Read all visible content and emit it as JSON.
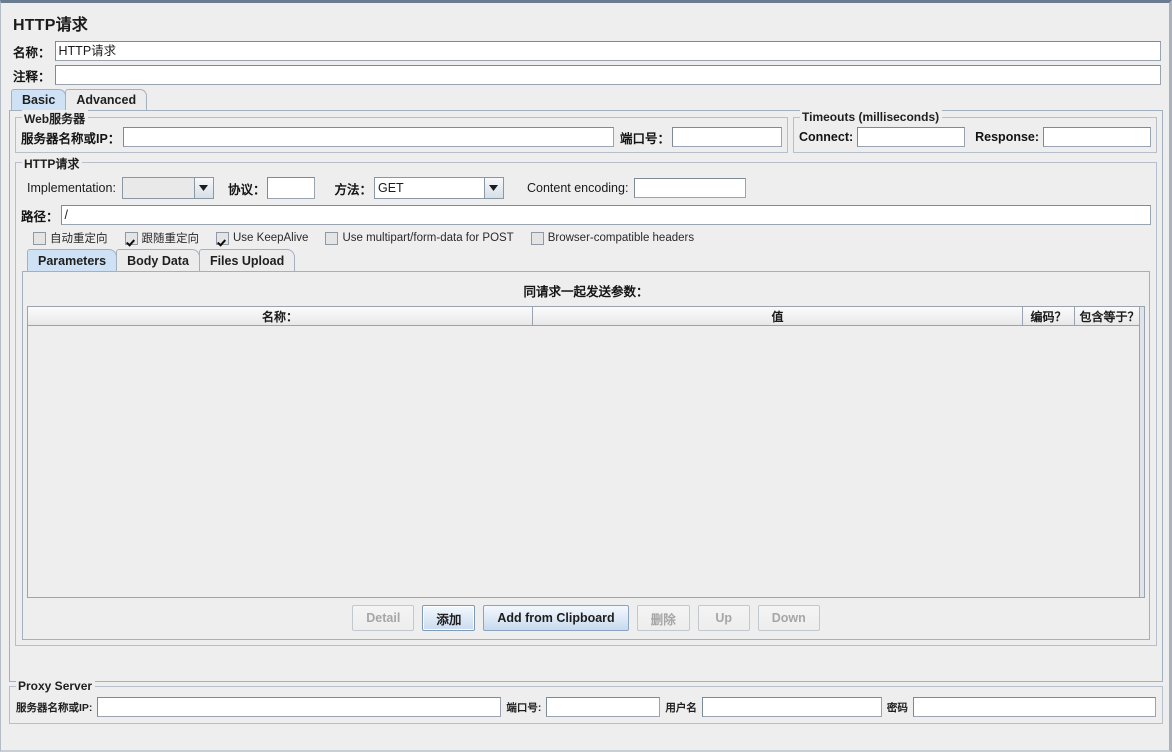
{
  "window": {
    "title": "HTTP请求"
  },
  "header": {
    "name_label": "名称：",
    "name_value": "HTTP请求",
    "comment_label": "注释：",
    "comment_value": ""
  },
  "tabs": [
    {
      "label": "Basic",
      "selected": true
    },
    {
      "label": "Advanced",
      "selected": false
    }
  ],
  "web_server": {
    "group_title": "Web服务器",
    "server_label": "服务器名称或IP：",
    "server_value": "",
    "port_label": "端口号：",
    "port_value": ""
  },
  "timeouts": {
    "group_title": "Timeouts (milliseconds)",
    "connect_label": "Connect:",
    "connect_value": "",
    "response_label": "Response:",
    "response_value": ""
  },
  "http_request": {
    "group_title": "HTTP请求",
    "implementation_label": "Implementation:",
    "implementation_value": "",
    "protocol_label": "协议：",
    "protocol_value": "",
    "method_label": "方法：",
    "method_value": "GET",
    "content_encoding_label": "Content encoding:",
    "content_encoding_value": "",
    "path_label": "路径：",
    "path_value": "/"
  },
  "options": [
    {
      "label": "自动重定向",
      "checked": false
    },
    {
      "label": "跟随重定向",
      "checked": true
    },
    {
      "label": "Use KeepAlive",
      "checked": true
    },
    {
      "label": "Use multipart/form-data for POST",
      "checked": false
    },
    {
      "label": "Browser-compatible headers",
      "checked": false
    }
  ],
  "data_tabs": [
    {
      "label": "Parameters",
      "selected": true
    },
    {
      "label": "Body Data",
      "selected": false
    },
    {
      "label": "Files Upload",
      "selected": false
    }
  ],
  "parameters": {
    "section_title": "同请求一起发送参数：",
    "columns": [
      "名称：",
      "值",
      "编码？",
      "包含等于？"
    ],
    "rows": []
  },
  "param_buttons": [
    {
      "label": "Detail",
      "state": "disabled"
    },
    {
      "label": "添加",
      "state": "focused"
    },
    {
      "label": "Add from Clipboard",
      "state": "primary"
    },
    {
      "label": "删除",
      "state": "disabled"
    },
    {
      "label": "Up",
      "state": "disabled"
    },
    {
      "label": "Down",
      "state": "disabled"
    }
  ],
  "proxy": {
    "group_title": "Proxy Server",
    "server_label": "服务器名称或IP:",
    "server_value": "",
    "port_label": "端口号:",
    "port_value": "",
    "username_label": "用户名",
    "username_value": "",
    "password_label": "密码",
    "password_value": ""
  },
  "colors": {
    "accent": "#cfe1f5",
    "window_bg": "#eeeeee",
    "border": "#a3b0c0"
  }
}
